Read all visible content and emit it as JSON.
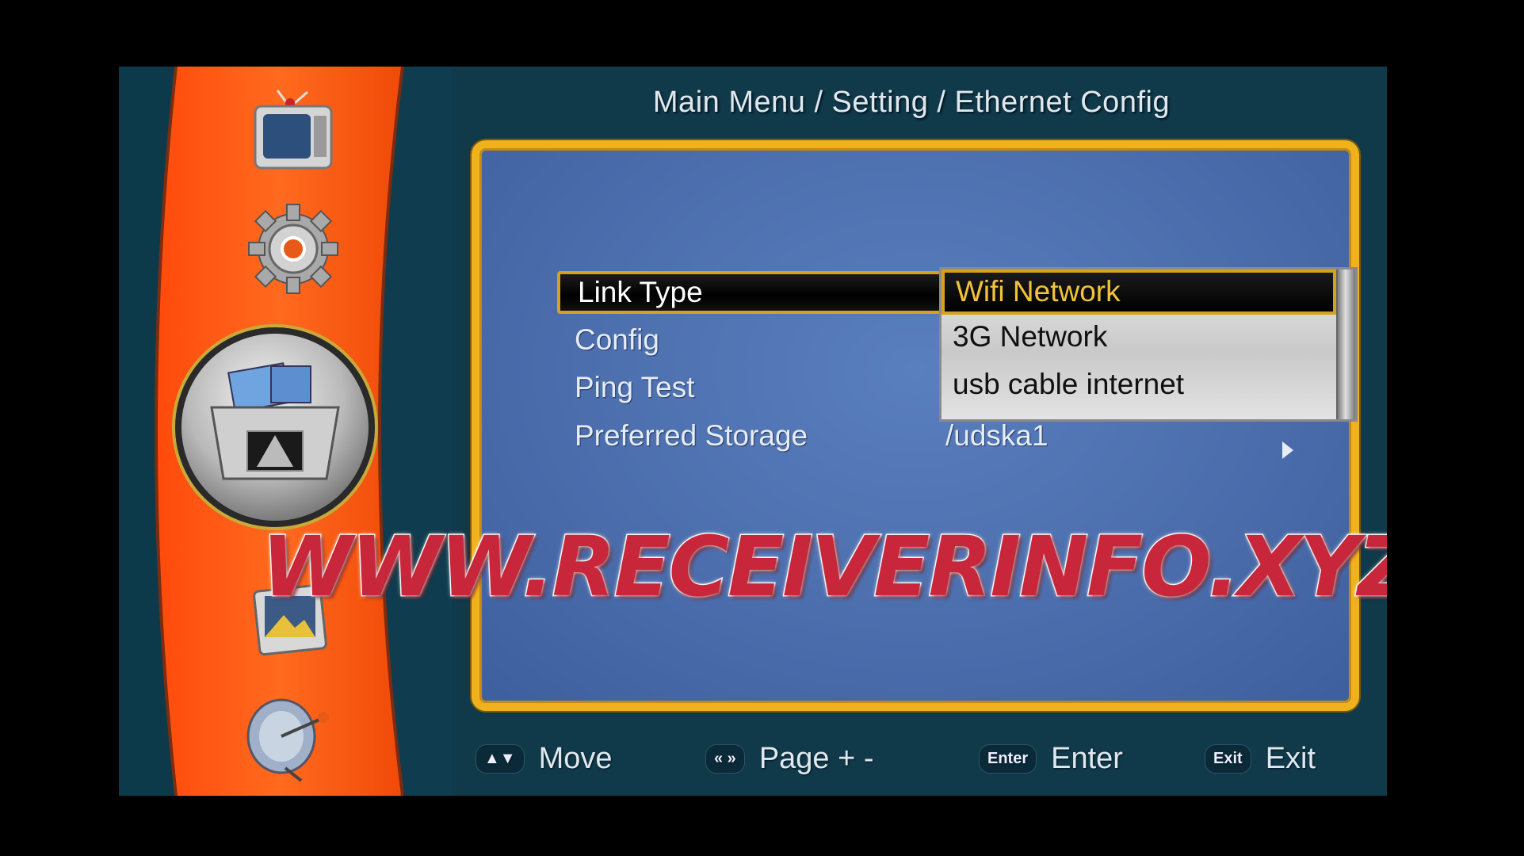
{
  "breadcrumb": "Main Menu / Setting / Ethernet Config",
  "sidebar": {
    "icons": [
      "tv-icon",
      "gear-icon",
      "media-box-icon",
      "photo-icon",
      "satellite-dish-icon"
    ],
    "active_index": 2,
    "colors": {
      "orange": "#ff5a14",
      "teal": "#10394a"
    }
  },
  "menu": {
    "rows": [
      {
        "label": "Link Type",
        "value": "Wifi Network",
        "selected": true
      },
      {
        "label": "Config",
        "value": ""
      },
      {
        "label": "Ping Test",
        "value": ""
      },
      {
        "label": "Preferred Storage",
        "value": "/udska1"
      }
    ]
  },
  "dropdown": {
    "options": [
      "Wifi Network",
      "3G Network",
      "usb cable internet"
    ],
    "highlighted": "Wifi Network"
  },
  "footer": {
    "move": {
      "key": "▲▼",
      "label": "Move"
    },
    "page": {
      "key": "« »",
      "label": "Page + -"
    },
    "enter": {
      "key": "Enter",
      "label": "Enter"
    },
    "exit": {
      "key": "Exit",
      "label": "Exit"
    }
  },
  "watermark": "WWW.RECEIVERINFO.XYZ",
  "colors": {
    "panel_border": "#f0b21c",
    "panel_bg": "#4a6cab",
    "highlight_text": "#f2c23c"
  }
}
